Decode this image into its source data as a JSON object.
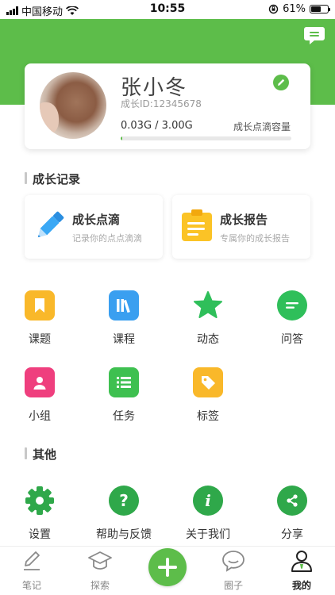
{
  "status_bar": {
    "carrier": "中国移动",
    "time": "10:55",
    "battery_text": "61%",
    "battery_level": 0.61
  },
  "profile": {
    "name": "张小冬",
    "id_text": "成长ID:12345678",
    "usage_text": "0.03G / 3.00G",
    "usage_label": "成长点滴容量",
    "usage_fraction": 0.01
  },
  "growth_section": {
    "title": "成长记录",
    "cards": [
      {
        "title": "成长点滴",
        "subtitle": "记录你的点点滴滴",
        "icon": "pencil-icon"
      },
      {
        "title": "成长报告",
        "subtitle": "专属你的成长报告",
        "icon": "clipboard-icon"
      }
    ]
  },
  "feature_grid": [
    {
      "label": "课题",
      "icon": "bookmark-icon",
      "color": "#f9b82a"
    },
    {
      "label": "课程",
      "icon": "books-icon",
      "color": "#3a9ff0"
    },
    {
      "label": "动态",
      "icon": "star-icon",
      "color": "#2fbf5a"
    },
    {
      "label": "问答",
      "icon": "chat-icon",
      "color": "#2fbf5a"
    },
    {
      "label": "小组",
      "icon": "user-icon",
      "color": "#ef3f7e"
    },
    {
      "label": "任务",
      "icon": "list-icon",
      "color": "#3ec050"
    },
    {
      "label": "标签",
      "icon": "tag-icon",
      "color": "#f9b82a"
    }
  ],
  "other_section": {
    "title": "其他",
    "items": [
      {
        "label": "设置",
        "icon": "gear-icon",
        "color": "#2fa84a"
      },
      {
        "label": "帮助与反馈",
        "icon": "help-icon",
        "color": "#2fa84a"
      },
      {
        "label": "关于我们",
        "icon": "info-icon",
        "color": "#2fa84a"
      },
      {
        "label": "分享",
        "icon": "share-icon",
        "color": "#2fa84a"
      }
    ]
  },
  "tab_bar": {
    "tabs": [
      {
        "label": "笔记",
        "icon": "note-icon"
      },
      {
        "label": "探索",
        "icon": "graduation-cap-icon"
      },
      {
        "label": "圈子",
        "icon": "speech-bubble-icon"
      },
      {
        "label": "我的",
        "icon": "person-icon",
        "active": true
      }
    ],
    "center_button": "plus-icon"
  },
  "theme": {
    "accent": "#5dbd4a"
  }
}
